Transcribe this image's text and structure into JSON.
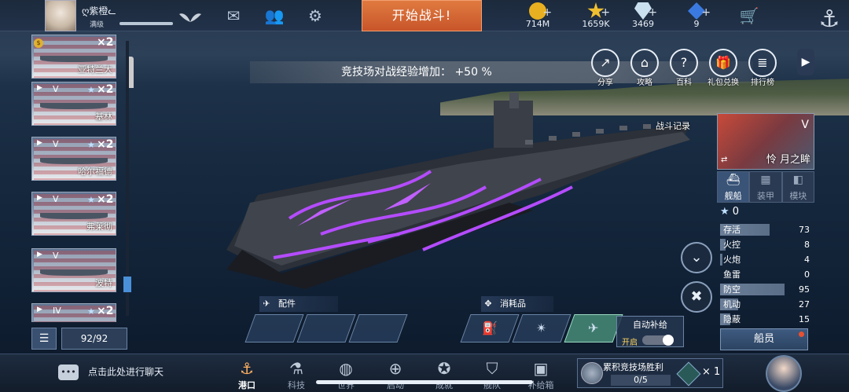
{
  "player": {
    "name": "ღ紫橙ᓚ",
    "level": "满级",
    "xp_fraction": 1.0
  },
  "topbar": {
    "battle_label": "开始战斗!",
    "resources": [
      {
        "icon": "gold-coin-icon",
        "value": "714M",
        "color": "#e8b020"
      },
      {
        "icon": "star-icon",
        "value": "1659K",
        "color": "#f0c030"
      },
      {
        "icon": "diamond-icon",
        "value": "3469",
        "color": "#c8e0f0"
      },
      {
        "icon": "blue-gem-icon",
        "value": "9",
        "color": "#3a7ae0"
      }
    ]
  },
  "banner": {
    "text": "竞技场对战经验增加：  +50 %"
  },
  "quick_actions": [
    "分享",
    "攻略",
    "百科",
    "礼包兑换",
    "排行榜"
  ],
  "fleet": [
    {
      "tier": "",
      "count": "×2",
      "name": "亚特兰大"
    },
    {
      "tier": "V",
      "count": "×2",
      "name": "基林"
    },
    {
      "tier": "V",
      "count": "×2",
      "name": "哈尔福德"
    },
    {
      "tier": "V",
      "count": "×2",
      "name": "弗莱彻"
    },
    {
      "tier": "V",
      "count": "",
      "name": "波特"
    },
    {
      "tier": "IV",
      "count": "×2",
      "name": ""
    }
  ],
  "fleet_count": "92/92",
  "battle_log": "战斗记录",
  "ship_panel": {
    "tier": "V",
    "name": "怜 月之眸",
    "tabs": [
      "舰船",
      "装甲",
      "模块"
    ],
    "stars": "0",
    "stats": [
      {
        "name": "存活",
        "value": "73",
        "level": 0.73
      },
      {
        "name": "火控",
        "value": "8",
        "level": 0.08
      },
      {
        "name": "火炮",
        "value": "4",
        "level": 0.04
      },
      {
        "name": "鱼雷",
        "value": "0",
        "level": 0
      },
      {
        "name": "防空",
        "value": "95",
        "level": 0.95
      },
      {
        "name": "机动",
        "value": "27",
        "level": 0.27
      },
      {
        "name": "隐蔽",
        "value": "15",
        "level": 0.15
      }
    ],
    "crew_label": "船员"
  },
  "parts": {
    "label": "配件"
  },
  "consumables": {
    "label": "消耗品",
    "auto_supply": "自动补给",
    "auto_state": "开启"
  },
  "chat": {
    "text": "点击此处进行聊天"
  },
  "nav": [
    "港口",
    "科技",
    "世界",
    "启动",
    "成就",
    "舰队",
    "补给箱"
  ],
  "arena_task": {
    "title": "累积竞技场胜利",
    "progress": "0/5",
    "reward": "× 1"
  }
}
